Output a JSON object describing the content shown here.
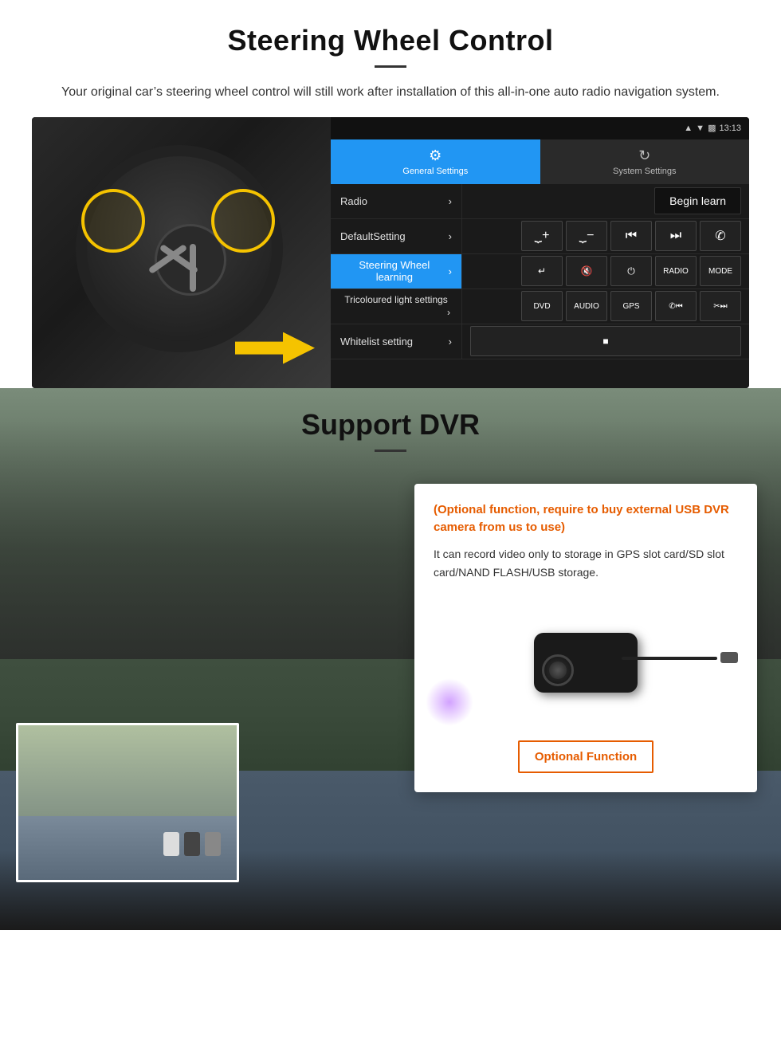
{
  "page": {
    "steering_section": {
      "title": "Steering Wheel Control",
      "subtitle": "Your original car’s steering wheel control will still work after installation of this all-in-one auto radio navigation system.",
      "status_bar": {
        "time": "13:13",
        "signal_icon": "▾▾",
        "wifi_icon": "▿",
        "battery_icon": "▐"
      },
      "tabs": [
        {
          "id": "general",
          "label": "General Settings",
          "icon": "⚙",
          "active": true
        },
        {
          "id": "system",
          "label": "System Settings",
          "icon": "↺",
          "active": false
        }
      ],
      "menu_items": [
        {
          "id": "radio",
          "label": "Radio",
          "active": false
        },
        {
          "id": "default",
          "label": "DefaultSetting",
          "active": false
        },
        {
          "id": "steering",
          "label": "Steering Wheel learning",
          "active": true
        },
        {
          "id": "tricoloured",
          "label": "Tricoloured light settings",
          "active": false
        },
        {
          "id": "whitelist",
          "label": "Whitelist setting",
          "active": false
        }
      ],
      "begin_learn_label": "Begin learn",
      "control_buttons": [
        [
          "⧼+",
          "⧽−",
          "⏮",
          "⏭",
          "☎"
        ],
        [
          "↩",
          "✕",
          "⏻",
          "RADIO",
          "MODE"
        ],
        [
          "DVD",
          "AUDIO",
          "GPS",
          "☎⏮",
          "✂⏭"
        ],
        [
          "■"
        ]
      ]
    },
    "dvr_section": {
      "title": "Support DVR",
      "optional_text": "(Optional function, require to buy external USB DVR camera from us to use)",
      "description": "It can record video only to storage in GPS slot card/SD slot card/NAND FLASH/USB storage.",
      "optional_function_label": "Optional Function"
    }
  }
}
